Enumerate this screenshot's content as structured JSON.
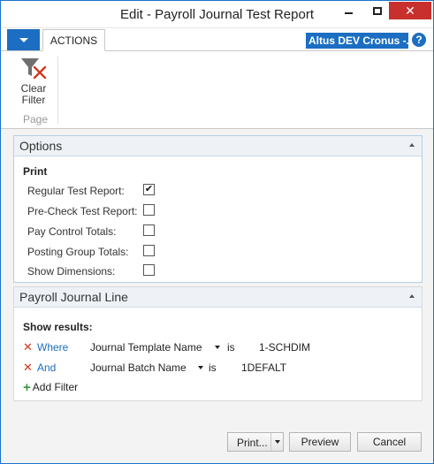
{
  "window": {
    "title": "Edit - Payroll Journal Test Report"
  },
  "ribbon": {
    "tab_actions": "ACTIONS",
    "company": "Altus DEV Cronus -...",
    "help": "?",
    "clear_filter_label_1": "Clear",
    "clear_filter_label_2": "Filter",
    "group_label": "Page"
  },
  "options": {
    "header": "Options",
    "section": "Print",
    "rows": [
      {
        "label": "Regular Test Report:",
        "checked": true,
        "mark": "✔"
      },
      {
        "label": "Pre-Check Test Report:",
        "checked": false,
        "mark": ""
      },
      {
        "label": "Pay Control Totals:",
        "checked": false,
        "mark": ""
      },
      {
        "label": "Posting Group Totals:",
        "checked": false,
        "mark": ""
      },
      {
        "label": "Show Dimensions:",
        "checked": false,
        "mark": ""
      }
    ]
  },
  "journal": {
    "header": "Payroll Journal Line",
    "show_results": "Show results:",
    "filters": [
      {
        "keyword": "Where",
        "field": "Journal Template Name",
        "operator": "is",
        "value": "1-SCHDIM"
      },
      {
        "keyword": "And",
        "field": "Journal Batch Name",
        "operator": "is",
        "value": "1DEFALT"
      }
    ],
    "add_filter": "Add Filter"
  },
  "footer": {
    "print": "Print...",
    "preview": "Preview",
    "cancel": "Cancel"
  },
  "colors": {
    "accent": "#1b6ec2",
    "close": "#c7302c",
    "remove_x": "#d0391d",
    "add_plus": "#3a9a3a"
  }
}
